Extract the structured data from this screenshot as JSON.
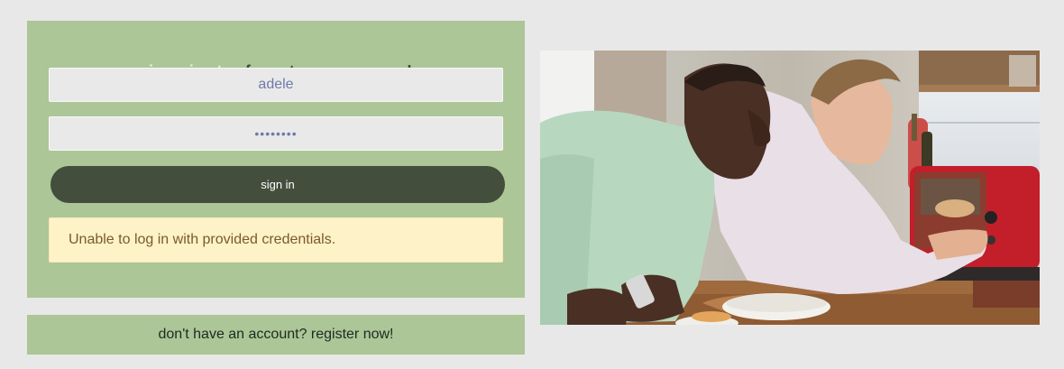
{
  "login": {
    "title_light": "sign in to",
    "title_dark": "feast your eyes!",
    "username_value": "adele",
    "password_value": "••••••••",
    "signin_label": "sign in",
    "error_message": "Unable to log in with provided credentials."
  },
  "register": {
    "link_text": "don't have an account? register now!"
  },
  "colors": {
    "panel_green": "#acc697",
    "button_dark": "#434e3c",
    "error_bg": "#fef2c9",
    "background": "#e8e8e8"
  }
}
